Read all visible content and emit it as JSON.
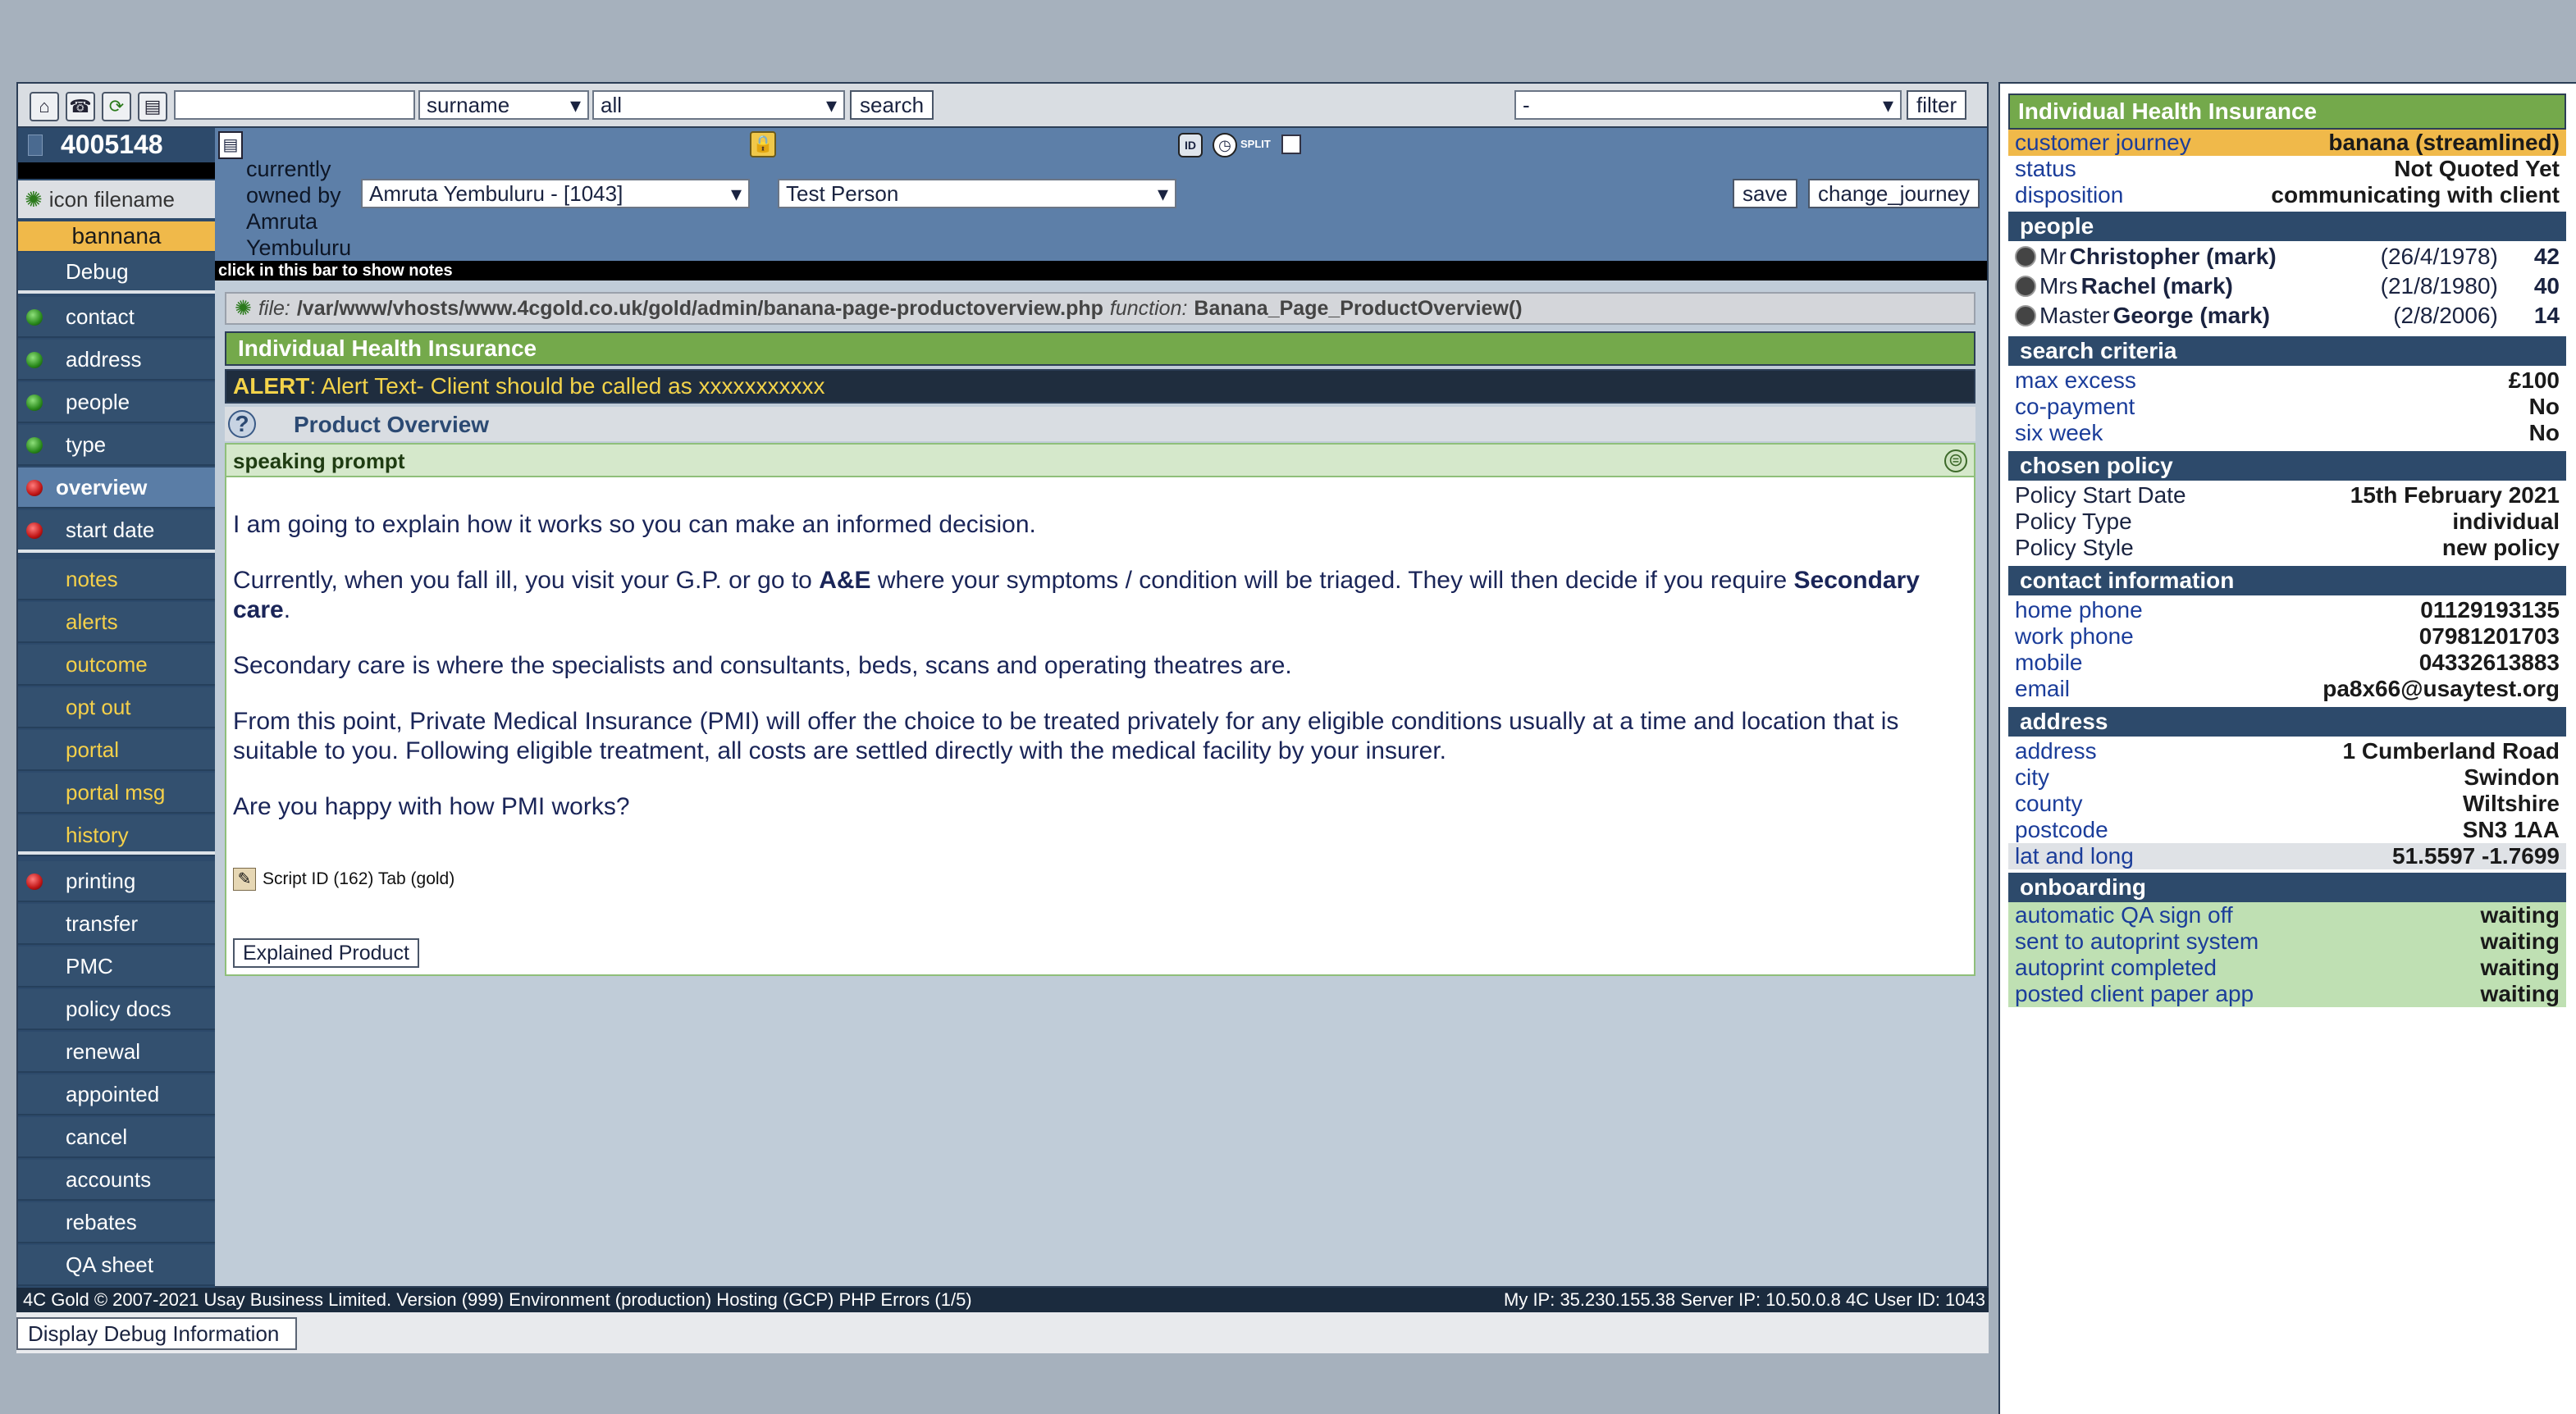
{
  "toolbar": {
    "search_value": "",
    "search_type": "surname",
    "search_scope": "all",
    "search_label": "search",
    "filter_value": "-",
    "filter_label": "filter"
  },
  "record": {
    "id": "4005148",
    "icon_filename_label": "icon filename",
    "brand": "bannana",
    "debug_label": "Debug"
  },
  "nav": {
    "group1": [
      {
        "label": "contact",
        "status": "green"
      },
      {
        "label": "address",
        "status": "green"
      },
      {
        "label": "people",
        "status": "green"
      },
      {
        "label": "type",
        "status": "green"
      },
      {
        "label": "overview",
        "status": "red",
        "active": true
      },
      {
        "label": "start date",
        "status": "red"
      }
    ],
    "group2": [
      "notes",
      "alerts",
      "outcome",
      "opt out",
      "portal",
      "portal msg",
      "history"
    ],
    "group3": [
      {
        "label": "printing",
        "status": "red"
      },
      {
        "label": "transfer"
      },
      {
        "label": "PMC"
      },
      {
        "label": "policy docs"
      },
      {
        "label": "renewal"
      },
      {
        "label": "appointed"
      },
      {
        "label": "cancel"
      },
      {
        "label": "accounts"
      },
      {
        "label": "rebates"
      },
      {
        "label": "QA sheet"
      }
    ]
  },
  "header": {
    "owned_by_text": "currently owned by Amruta Yembuluru",
    "owner_select": "Amruta Yembuluru - [1043]",
    "person_select": "Test Person",
    "save_label": "save",
    "change_journey_label": "change_journey",
    "split_label": "SPLIT",
    "notes_hint": "click in this bar to show notes"
  },
  "main": {
    "file_prefix": "file:",
    "file_path": "/var/www/vhosts/www.4cgold.co.uk/gold/admin/banana-page-productoverview.php",
    "function_prefix": "function:",
    "function_name": "Banana_Page_ProductOverview()",
    "section_title": "Individual Health Insurance",
    "alert_label": "ALERT",
    "alert_text": ": Alert Text- Client should be called as xxxxxxxxxxx",
    "page_title": "Product Overview",
    "speaking_prompt_label": "speaking prompt",
    "p1": "I am going to explain how it works so you can make an informed decision.",
    "p2a": "Currently, when you fall ill, you visit your G.P. or go to ",
    "p2b": "A&E",
    "p2c": " where your symptoms / condition will be triaged. They will then decide if you require ",
    "p2d": "Secondary care",
    "p2e": ".",
    "p3": "Secondary care is where the specialists and consultants, beds, scans and operating theatres are.",
    "p4": "From this point, Private Medical Insurance (PMI) will offer the choice to be treated privately for any eligible conditions usually at a time and location that is suitable to you. Following eligible treatment, all costs are settled directly with the medical facility by your insurer.",
    "p5": "Are you happy with how PMI works?",
    "script_id": "Script ID (162) Tab (gold)",
    "explained_button": "Explained Product"
  },
  "footer": {
    "left": "4C Gold © 2007-2021 Usay Business Limited. Version (999) Environment (production) Hosting (GCP) PHP Errors (1/5)",
    "right": "My IP: 35.230.155.38 Server IP: 10.50.0.8 4C User ID: 1043",
    "debug_button": "Display Debug Information"
  },
  "panel": {
    "title": "Individual Health Insurance",
    "customer_journey_label": "customer journey",
    "customer_journey_value": "banana (streamlined)",
    "status_label": "status",
    "status_value": "Not Quoted Yet",
    "disposition_label": "disposition",
    "disposition_value": "communicating with client",
    "people_title": "people",
    "people": [
      {
        "title": "Mr",
        "name": "Christopher (mark)",
        "dob": "(26/4/1978)",
        "age": "42"
      },
      {
        "title": "Mrs",
        "name": "Rachel (mark)",
        "dob": "(21/8/1980)",
        "age": "40"
      },
      {
        "title": "Master",
        "name": "George (mark)",
        "dob": "(2/8/2006)",
        "age": "14"
      }
    ],
    "search_title": "search criteria",
    "max_excess_label": "max excess",
    "max_excess_value": "£100",
    "copay_label": "co-payment",
    "copay_value": "No",
    "sixweek_label": "six week",
    "sixweek_value": "No",
    "policy_title": "chosen policy",
    "start_label": "Policy Start Date",
    "start_value": "15th February 2021",
    "type_label": "Policy Type",
    "type_value": "individual",
    "style_label": "Policy Style",
    "style_value": "new policy",
    "contact_title": "contact information",
    "home_label": "home phone",
    "home_value": "01129193135",
    "work_label": "work phone",
    "work_value": "07981201703",
    "mobile_label": "mobile",
    "mobile_value": "04332613883",
    "email_label": "email",
    "email_value": "pa8x66@usaytest.org",
    "address_title": "address",
    "addr_label": "address",
    "addr_value": "1 Cumberland Road",
    "city_label": "city",
    "city_value": "Swindon",
    "county_label": "county",
    "county_value": "Wiltshire",
    "postcode_label": "postcode",
    "postcode_value": "SN3 1AA",
    "latlong_label": "lat and long",
    "latlong_value": "51.5597 -1.7699",
    "onboarding_title": "onboarding",
    "ob1_label": "automatic QA sign off",
    "ob1_value": "waiting",
    "ob2_label": "sent to autoprint system",
    "ob2_value": "waiting",
    "ob3_label": "autoprint completed",
    "ob3_value": "waiting",
    "ob4_label": "posted client paper app",
    "ob4_value": "waiting"
  }
}
